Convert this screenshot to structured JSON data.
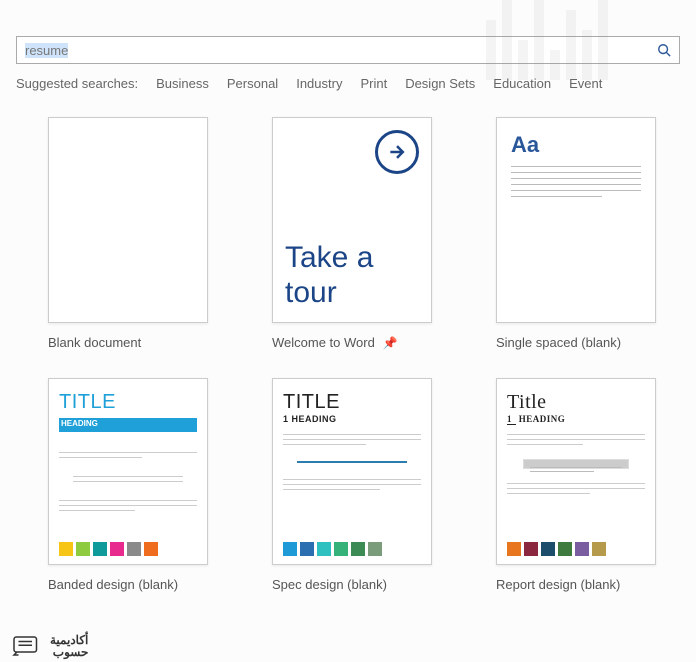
{
  "search": {
    "value": "resume"
  },
  "suggested": {
    "label": "Suggested searches:",
    "items": [
      "Business",
      "Personal",
      "Industry",
      "Print",
      "Design Sets",
      "Education",
      "Event"
    ]
  },
  "templates": [
    {
      "caption": "Blank document",
      "pinned": false
    },
    {
      "caption": "Welcome to Word",
      "pinned": true,
      "tour_text": "Take a tour"
    },
    {
      "caption": "Single spaced (blank)",
      "pinned": false,
      "aa": "Aa"
    },
    {
      "caption": "Banded design (blank)",
      "pinned": false,
      "title": "TITLE",
      "heading": "HEADING",
      "swatches": [
        "#f7c516",
        "#8ecb3e",
        "#109b9b",
        "#e82a8e",
        "#8a8a8a",
        "#ef6c1f"
      ]
    },
    {
      "caption": "Spec design (blank)",
      "pinned": false,
      "title": "TITLE",
      "heading": "HEADING",
      "heading_num": "1",
      "swatches": [
        "#1e9bd7",
        "#2c6fb1",
        "#2fc0c0",
        "#35b27a",
        "#3c8b55",
        "#7a9c7a"
      ]
    },
    {
      "caption": "Report design (blank)",
      "pinned": false,
      "title": "Title",
      "heading": "HEADING",
      "heading_num": "1",
      "swatches": [
        "#e8761f",
        "#8c2740",
        "#1c4d6b",
        "#3f7a3f",
        "#7a5ca0",
        "#b69a4b"
      ]
    }
  ],
  "watermark": {
    "line1": "أكاديمية",
    "line2": "حسوب"
  }
}
